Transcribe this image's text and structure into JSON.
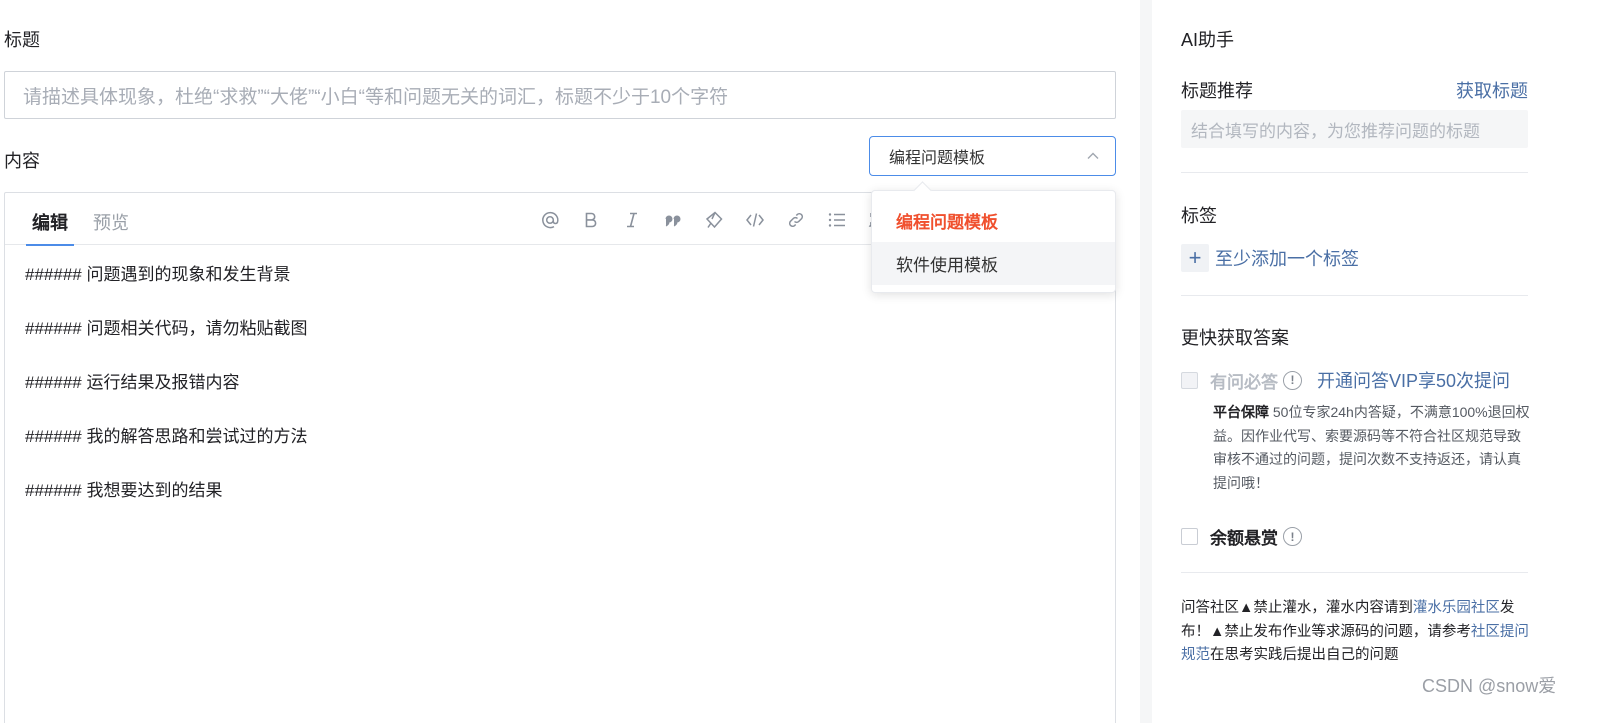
{
  "form": {
    "title_label": "标题",
    "title_placeholder": "请描述具体现象，杜绝“求救”“大佬”“小白“等和问题无关的词汇，标题不少于10个字符",
    "content_label": "内容",
    "template_select": {
      "value": "编程问题模板",
      "options": [
        "编程问题模板",
        "软件使用模板"
      ]
    }
  },
  "editor": {
    "tabs": [
      "编辑",
      "预览"
    ],
    "toolbar_icons": [
      "at-icon",
      "bold-icon",
      "italic-icon",
      "quote-icon",
      "brush-icon",
      "code-icon",
      "link-icon",
      "unordered-list-icon",
      "ordered-list-icon"
    ],
    "lines": [
      "###### 问题遇到的现象和发生背景",
      "###### 问题相关代码，请勿粘贴截图",
      "###### 运行结果及报错内容",
      "###### 我的解答思路和尝试过的方法",
      "###### 我想要达到的结果"
    ]
  },
  "sidebar": {
    "title": "AI助手",
    "title_rec_label": "标题推荐",
    "get_title_link": "获取标题",
    "title_rec_placeholder": "结合填写的内容，为您推荐问题的标题",
    "tags_label": "标签",
    "add_tag_label": "至少添加一个标签",
    "faster_label": "更快获取答案",
    "vip": {
      "name": "有问必答",
      "link": "开通问答VIP享50次提问",
      "guarantee_title": "平台保障",
      "guarantee_text": " 50位专家24h内答疑，不满意100%退回权益。因作业代写、索要源码等不符合社区规范导致审核不通过的问题，提问次数不支持返还，请认真提问哦！"
    },
    "bounty_label": "余额悬赏",
    "notice": {
      "p1": "问答社区▲禁止灌水，灌水内容请到",
      "link1": "灌水乐园社区",
      "p2": "发布！▲禁止发布作业等求源码的问题，请参考",
      "link2": "社区提问规范",
      "p3": "在思考实践后提出自己的问题"
    }
  },
  "watermark": "CSDN @snow爱",
  "colors": {
    "accent_blue": "#4c8ce8",
    "link_blue": "#4a6fa5",
    "selected_orange": "#f0502e"
  }
}
